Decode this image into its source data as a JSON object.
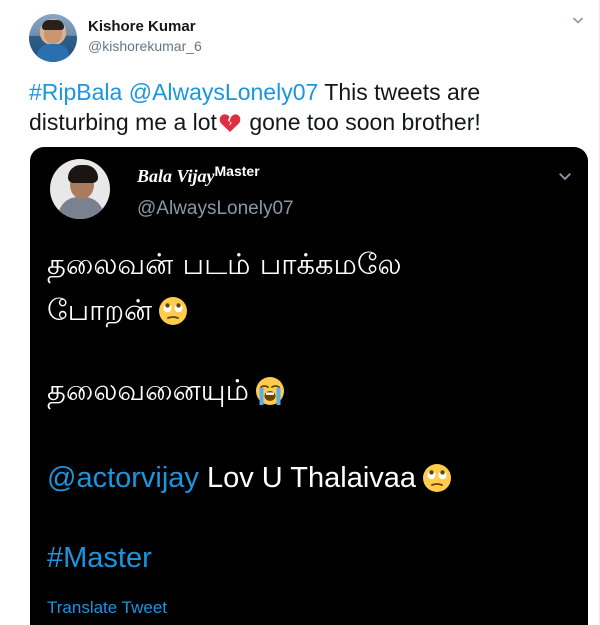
{
  "outer_tweet": {
    "user_name": "Kishore Kumar",
    "user_handle": "@kishorekumar_6",
    "text_hashtag": "#RipBala",
    "text_mention": "@AlwaysLonely07",
    "text_part1": " This tweets are disturbing me a lot",
    "text_part2": " gone too soon brother!",
    "text_emoji": "broken-heart-icon"
  },
  "quoted_tweet": {
    "user_name": "Bala Vijay",
    "user_name_sup": "Master",
    "user_handle": "@AlwaysLonely07",
    "line1": "தலைவன் படம் பாக்கமலே",
    "line2": "போறன்",
    "line3": "தலைவனையும்",
    "mention": "@actorvijay",
    "line4_rest": " Lov U Thalaivaa",
    "hashtag": "#Master",
    "translate_label": "Translate Tweet"
  },
  "icons": {
    "eye_roll_emoji": "eye-roll-face-icon",
    "crying_emoji": "loudly-crying-face-icon",
    "chevron": "chevron-down-icon"
  },
  "colors": {
    "link": "#1b95e0",
    "card_background": "#000000",
    "secondary_text": "#657786"
  }
}
